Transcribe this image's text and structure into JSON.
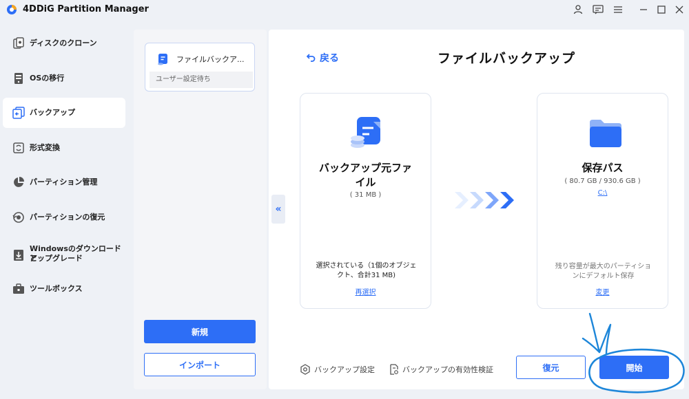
{
  "app": {
    "title": "4DDiG Partition Manager"
  },
  "sidebar": {
    "items": [
      {
        "label": "ディスクのクローン",
        "icon": "disk-clone-icon",
        "active": false
      },
      {
        "label": "OSの移行",
        "icon": "os-migrate-icon",
        "active": false
      },
      {
        "label": "バックアップ",
        "icon": "backup-icon",
        "active": true
      },
      {
        "label": "形式変換",
        "icon": "convert-icon",
        "active": false
      },
      {
        "label": "パーティション管理",
        "icon": "pie-chart-icon",
        "active": false
      },
      {
        "label": "パーティションの復元",
        "icon": "partition-restore-icon",
        "active": false
      },
      {
        "label": "Windowsのダウンロードとアップグレード",
        "label_line1": "Windowsのダウンロードと",
        "label_line2": "アップグレード",
        "icon": "windows-download-icon",
        "active": false
      },
      {
        "label": "ツールボックス",
        "icon": "toolbox-icon",
        "active": false
      }
    ]
  },
  "task_panel": {
    "task": {
      "title": "ファイルバックア...",
      "status": "ユーザー設定待ち"
    },
    "new_label": "新規",
    "import_label": "インポート"
  },
  "main": {
    "back_label": "戻る",
    "title": "ファイルバックアップ",
    "source": {
      "title_line1": "バックアップ元ファ",
      "title_line2": "イル",
      "size": "( 31 MB )",
      "desc_line1": "選択されている（1個のオブジェ",
      "desc_line2": "クト、合計31 MB)",
      "link": "再選択"
    },
    "destination": {
      "title": "保存パス",
      "size": "( 80.7 GB / 930.6 GB )",
      "path": "C:\\",
      "desc_line1": "残り容量が最大のパーティショ",
      "desc_line2": "ンにデフォルト保存",
      "link": "変更"
    },
    "options": {
      "settings_label": "バックアップ設定",
      "verify_label": "バックアップの有効性検証"
    },
    "restore_label": "復元",
    "start_label": "開始"
  },
  "colors": {
    "accent": "#2d6ef6",
    "annotation": "#1d86d9"
  }
}
